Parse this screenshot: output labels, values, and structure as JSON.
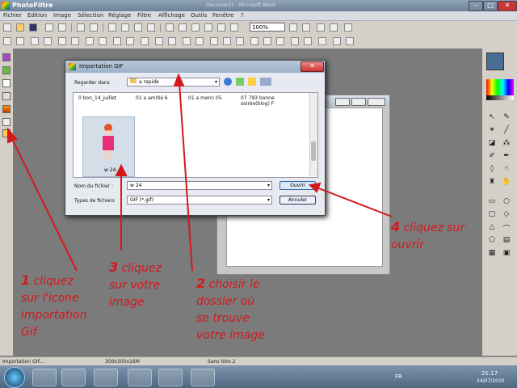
{
  "window": {
    "title": "PhotoFiltre",
    "doc_title": "Document1 - Microsoft Word"
  },
  "menu": [
    "Fichier",
    "Edition",
    "Image",
    "Sélection",
    "Réglage",
    "Filtre",
    "Affichage",
    "Outils",
    "Fenêtre",
    "?"
  ],
  "toolbar": {
    "zoom": "100%"
  },
  "dialog": {
    "title": "Importation GIF",
    "look_in_label": "Regarder dans",
    "look_in_value": "a rapide",
    "files": [
      "0 bon_14_juillet",
      "01 a amitié 6",
      "01 a merci 05",
      "07 793 bonne soirée(blog) F"
    ],
    "thumb_label": "w 24",
    "filename_label": "Nom du fichier :",
    "filename_value": "w 24",
    "filetype_label": "Types de fichiers",
    "filetype_value": "GIF (*.gif)",
    "open_button": "Ouvrir",
    "cancel_button": "Annuler"
  },
  "status": {
    "left": "Importation GIF...",
    "size": "300x300x16M",
    "doc": "Sans titre 2"
  },
  "taskbar": {
    "lang": "FR",
    "time": "21:17",
    "date": "24/07/2010"
  },
  "annotations": {
    "step1_num": "1",
    "step1": [
      "cliquez",
      "sur l'icone",
      "importation",
      "Gif"
    ],
    "step2_num": "2",
    "step2": [
      "choisir le",
      "dossier où",
      "se trouve",
      "votre image"
    ],
    "step3_num": "3",
    "step3": [
      "cliquez",
      "sur votre",
      "image"
    ],
    "step4_num": "4",
    "step4": [
      "cliquez sur",
      "ouvrir"
    ]
  },
  "colors": {
    "annotation": "#d4181c",
    "foreground_swatch": "#4a6d96"
  }
}
